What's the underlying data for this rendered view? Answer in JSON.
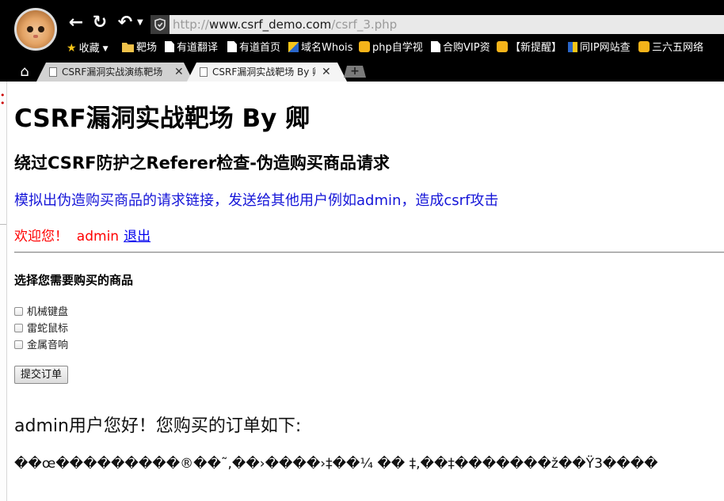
{
  "browser": {
    "url": {
      "scheme": "http://",
      "host": "www.csrf_demo.com",
      "path": "/csrf_3.php"
    },
    "nav_icons": [
      "back-arrow-icon",
      "refresh-icon",
      "undo-icon",
      "shield-icon"
    ],
    "bookmarks": [
      {
        "label": "收藏",
        "icon": "star-icon"
      },
      {
        "label": "靶场",
        "icon": "folder-icon"
      },
      {
        "label": "有道翻译",
        "icon": "page-icon"
      },
      {
        "label": "有道首页",
        "icon": "page-icon"
      },
      {
        "label": "域名Whois",
        "icon": "whois-icon"
      },
      {
        "label": "php自学视",
        "icon": "sun-icon"
      },
      {
        "label": "合购VIP资",
        "icon": "page-icon"
      },
      {
        "label": "【新提醒】",
        "icon": "sun-icon"
      },
      {
        "label": "同IP网站查",
        "icon": "ip-icon"
      },
      {
        "label": "三六五网络",
        "icon": "sun-icon"
      }
    ],
    "tabs": [
      {
        "title": "CSRF漏洞实战演练靶场",
        "active": false
      },
      {
        "title": "CSRF漏洞实战靶场 By 卿",
        "active": true
      }
    ],
    "close_glyph": "✕",
    "new_tab_glyph": "+"
  },
  "page": {
    "title": "CSRF漏洞实战靶场 By 卿",
    "subtitle": "绕过CSRF防护之Referer检查-伪造购买商品请求",
    "description": "模拟出伪造购买商品的请求链接，发送给其他用户例如admin，造成csrf攻击",
    "welcome_text": "欢迎您！  admin",
    "logout_label": "退出",
    "select_heading": "选择您需要购买的商品",
    "products": [
      "机械键盘",
      "雷蛇鼠标",
      "金属音响"
    ],
    "submit_label": "提交订单",
    "order_heading": "admin用户您好！您购买的订单如下:",
    "order_output": "��œ���������®��˜,��›����›‡��¼ �� ‡,��‡�������ž��Ÿ3����"
  },
  "colors": {
    "description": "#1515d8",
    "welcome": "#ff0000",
    "link": "#0000ee",
    "chrome_bg": "#000000"
  }
}
